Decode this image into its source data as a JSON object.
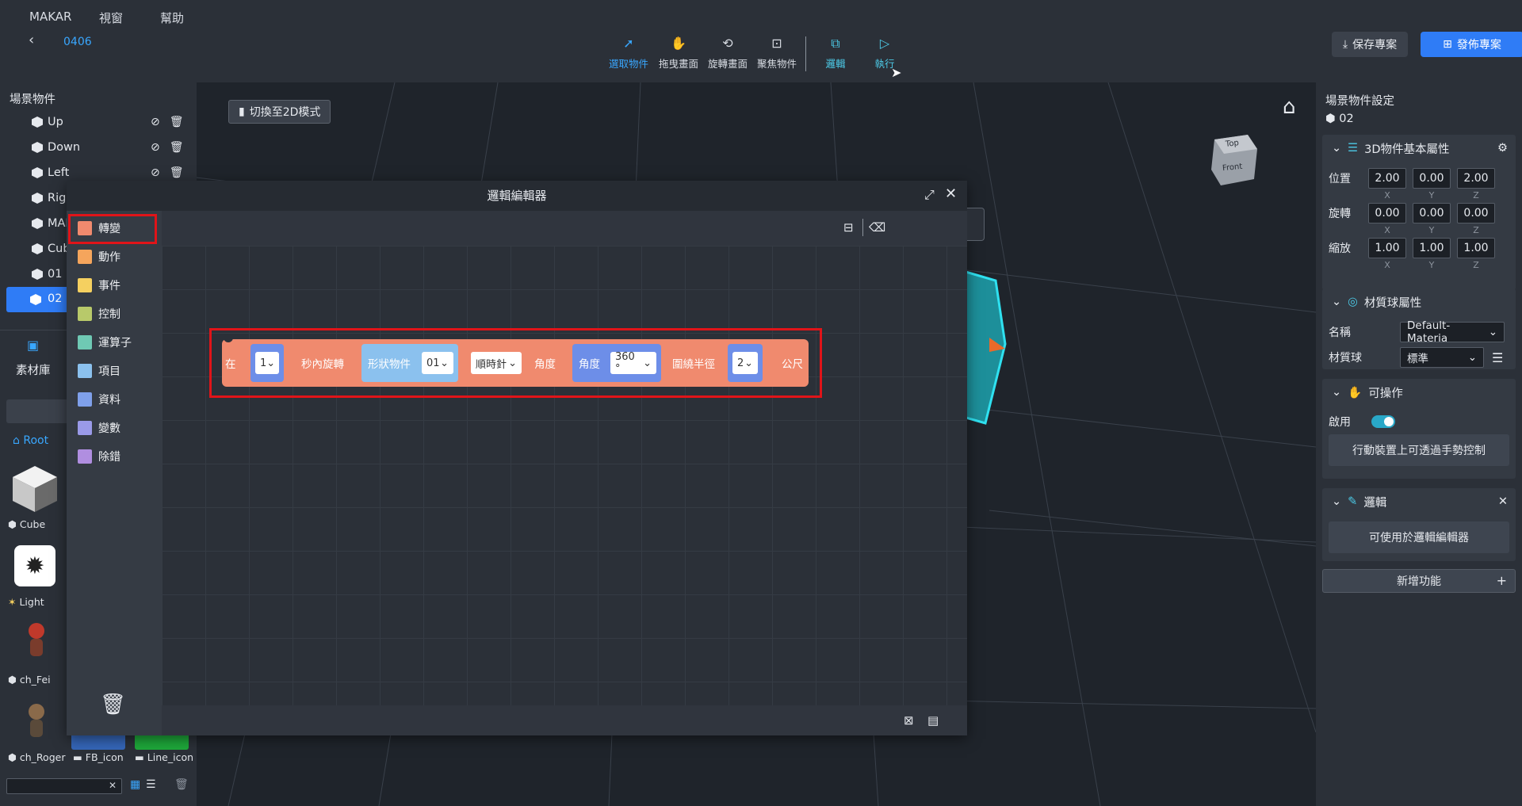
{
  "menu": {
    "app": "MAKAR",
    "window": "視窗",
    "help": "幫助"
  },
  "project": {
    "name": "0406"
  },
  "tools": {
    "select": "選取物件",
    "pan": "拖曳畫面",
    "rotate": "旋轉畫面",
    "focus": "聚焦物件",
    "logic": "邏輯",
    "run": "執行"
  },
  "actions": {
    "save": "保存專案",
    "publish": "發佈專案"
  },
  "scene": {
    "title": "場景物件",
    "items": [
      {
        "label": "Up"
      },
      {
        "label": "Down"
      },
      {
        "label": "Left"
      },
      {
        "label": "Rigl"
      },
      {
        "label": "MAI"
      },
      {
        "label": "Cub"
      },
      {
        "label": "01"
      },
      {
        "label": "02"
      }
    ]
  },
  "assets": {
    "title": "素材庫",
    "root": "Root",
    "items": [
      {
        "label": "Cube"
      },
      {
        "label": "Light"
      },
      {
        "label": "ch_Fei"
      },
      {
        "label": "ch_Roger"
      },
      {
        "label": "FB_icon"
      },
      {
        "label": "Line_icon"
      }
    ],
    "search_placeholder": ""
  },
  "viewport": {
    "toggle_2d": "切換至2D模式",
    "gizmo_top": "Top",
    "gizmo_front": "Front"
  },
  "logic_editor": {
    "title": "邏輯編輯器",
    "categories": [
      {
        "label": "轉變",
        "color": "#f08a6e"
      },
      {
        "label": "動作",
        "color": "#f5a55c"
      },
      {
        "label": "事件",
        "color": "#f5d060"
      },
      {
        "label": "控制",
        "color": "#b8c96a"
      },
      {
        "label": "運算子",
        "color": "#6fc9b4"
      },
      {
        "label": "項目",
        "color": "#8bc1ee"
      },
      {
        "label": "資料",
        "color": "#7fa0ea"
      },
      {
        "label": "變數",
        "color": "#9a9ae8"
      },
      {
        "label": "除錯",
        "color": "#b08ee0"
      }
    ],
    "block": {
      "at": "在",
      "seconds_value": "1",
      "seconds_label": "秒內旋轉",
      "object_label": "形狀物件",
      "object_value": "01",
      "direction_value": "順時針",
      "angle_label": "角度",
      "angle_slot_label": "角度",
      "angle_value": "360 °",
      "radius_label": "圍繞半徑",
      "radius_value": "2",
      "unit": "公尺"
    }
  },
  "properties": {
    "title": "場景物件設定",
    "object_name": "02",
    "basic": {
      "title": "3D物件基本屬性",
      "position_label": "位置",
      "rotation_label": "旋轉",
      "scale_label": "縮放",
      "position": [
        "2.00",
        "0.00",
        "2.00"
      ],
      "rotation": [
        "0.00",
        "0.00",
        "0.00"
      ],
      "scale": [
        "1.00",
        "1.00",
        "1.00"
      ],
      "axes": [
        "X",
        "Y",
        "Z"
      ]
    },
    "material": {
      "title": "材質球屬性",
      "name_label": "名稱",
      "name_value": "Default-Materia",
      "ball_label": "材質球",
      "ball_value": "標準"
    },
    "interactive": {
      "title": "可操作",
      "enable_label": "啟用",
      "enabled": true,
      "description": "行動裝置上可透過手勢控制"
    },
    "logic": {
      "title": "邏輯",
      "description": "可使用於邏輯編輯器"
    },
    "add_feature": "新增功能"
  },
  "colors": {
    "accent": "#2f7cf6",
    "highlight": "#e01419",
    "teal": "#4cc9e6"
  }
}
